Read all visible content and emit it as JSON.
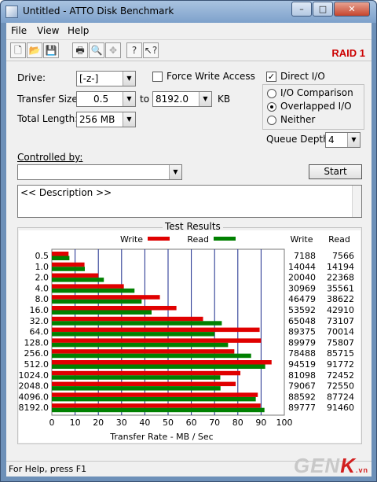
{
  "window": {
    "title": "Untitled - ATTO Disk Benchmark",
    "minimize": "–",
    "maximize": "□",
    "close": "✕"
  },
  "menu": {
    "file": "File",
    "view": "View",
    "help": "Help"
  },
  "toolbar": {
    "badge": "RAID 1"
  },
  "settings": {
    "drive_label": "Drive:",
    "drive_value": "[-z-]",
    "force_write": "Force Write Access",
    "force_write_checked": false,
    "direct_io": "Direct I/O",
    "direct_io_checked": true,
    "transfer_label": "Transfer Size:",
    "transfer_from": "0.5",
    "to_label": "to",
    "transfer_to": "8192.0",
    "kb_label": "KB",
    "length_label": "Total Length:",
    "length_value": "256 MB",
    "io_comparison": "I/O Comparison",
    "overlapped_io": "Overlapped I/O",
    "neither": "Neither",
    "selected_mode": "Overlapped I/O",
    "queue_label": "Queue Depth:",
    "queue_value": "4",
    "controlled_label": "Controlled by:",
    "controlled_value": "",
    "start_label": "Start",
    "description": "<< Description >>"
  },
  "results": {
    "title": "Test Results",
    "write_header": "Write",
    "read_header": "Read",
    "legend_write": "Write",
    "legend_read": "Read"
  },
  "chart_data": {
    "type": "bar",
    "orientation": "horizontal",
    "categories": [
      "0.5",
      "1.0",
      "2.0",
      "4.0",
      "8.0",
      "16.0",
      "32.0",
      "64.0",
      "128.0",
      "256.0",
      "512.0",
      "1024.0",
      "2048.0",
      "4096.0",
      "8192.0"
    ],
    "series": [
      {
        "name": "Write",
        "color": "#e00000",
        "values": [
          7188,
          14044,
          20040,
          30969,
          46479,
          53592,
          65048,
          89375,
          89979,
          78488,
          94519,
          81098,
          79067,
          88592,
          89777
        ]
      },
      {
        "name": "Read",
        "color": "#008000",
        "values": [
          7566,
          14194,
          22368,
          35561,
          38622,
          42910,
          73107,
          70014,
          75807,
          85715,
          91772,
          72452,
          72550,
          87724,
          91460
        ]
      }
    ],
    "xlabel": "Transfer Rate - MB / Sec",
    "xlim": [
      0,
      100
    ],
    "xticks": [
      "0",
      "10",
      "20",
      "30",
      "40",
      "50",
      "60",
      "70",
      "80",
      "90",
      "100"
    ],
    "grid": true,
    "legend": "top"
  },
  "status": {
    "text": "For Help, press F1"
  },
  "watermark": {
    "prefix": "GEN",
    "k": "K",
    "suffix": ".vn"
  },
  "colors": {
    "write": "#e00000",
    "read": "#008000",
    "raid": "#cc0000"
  }
}
